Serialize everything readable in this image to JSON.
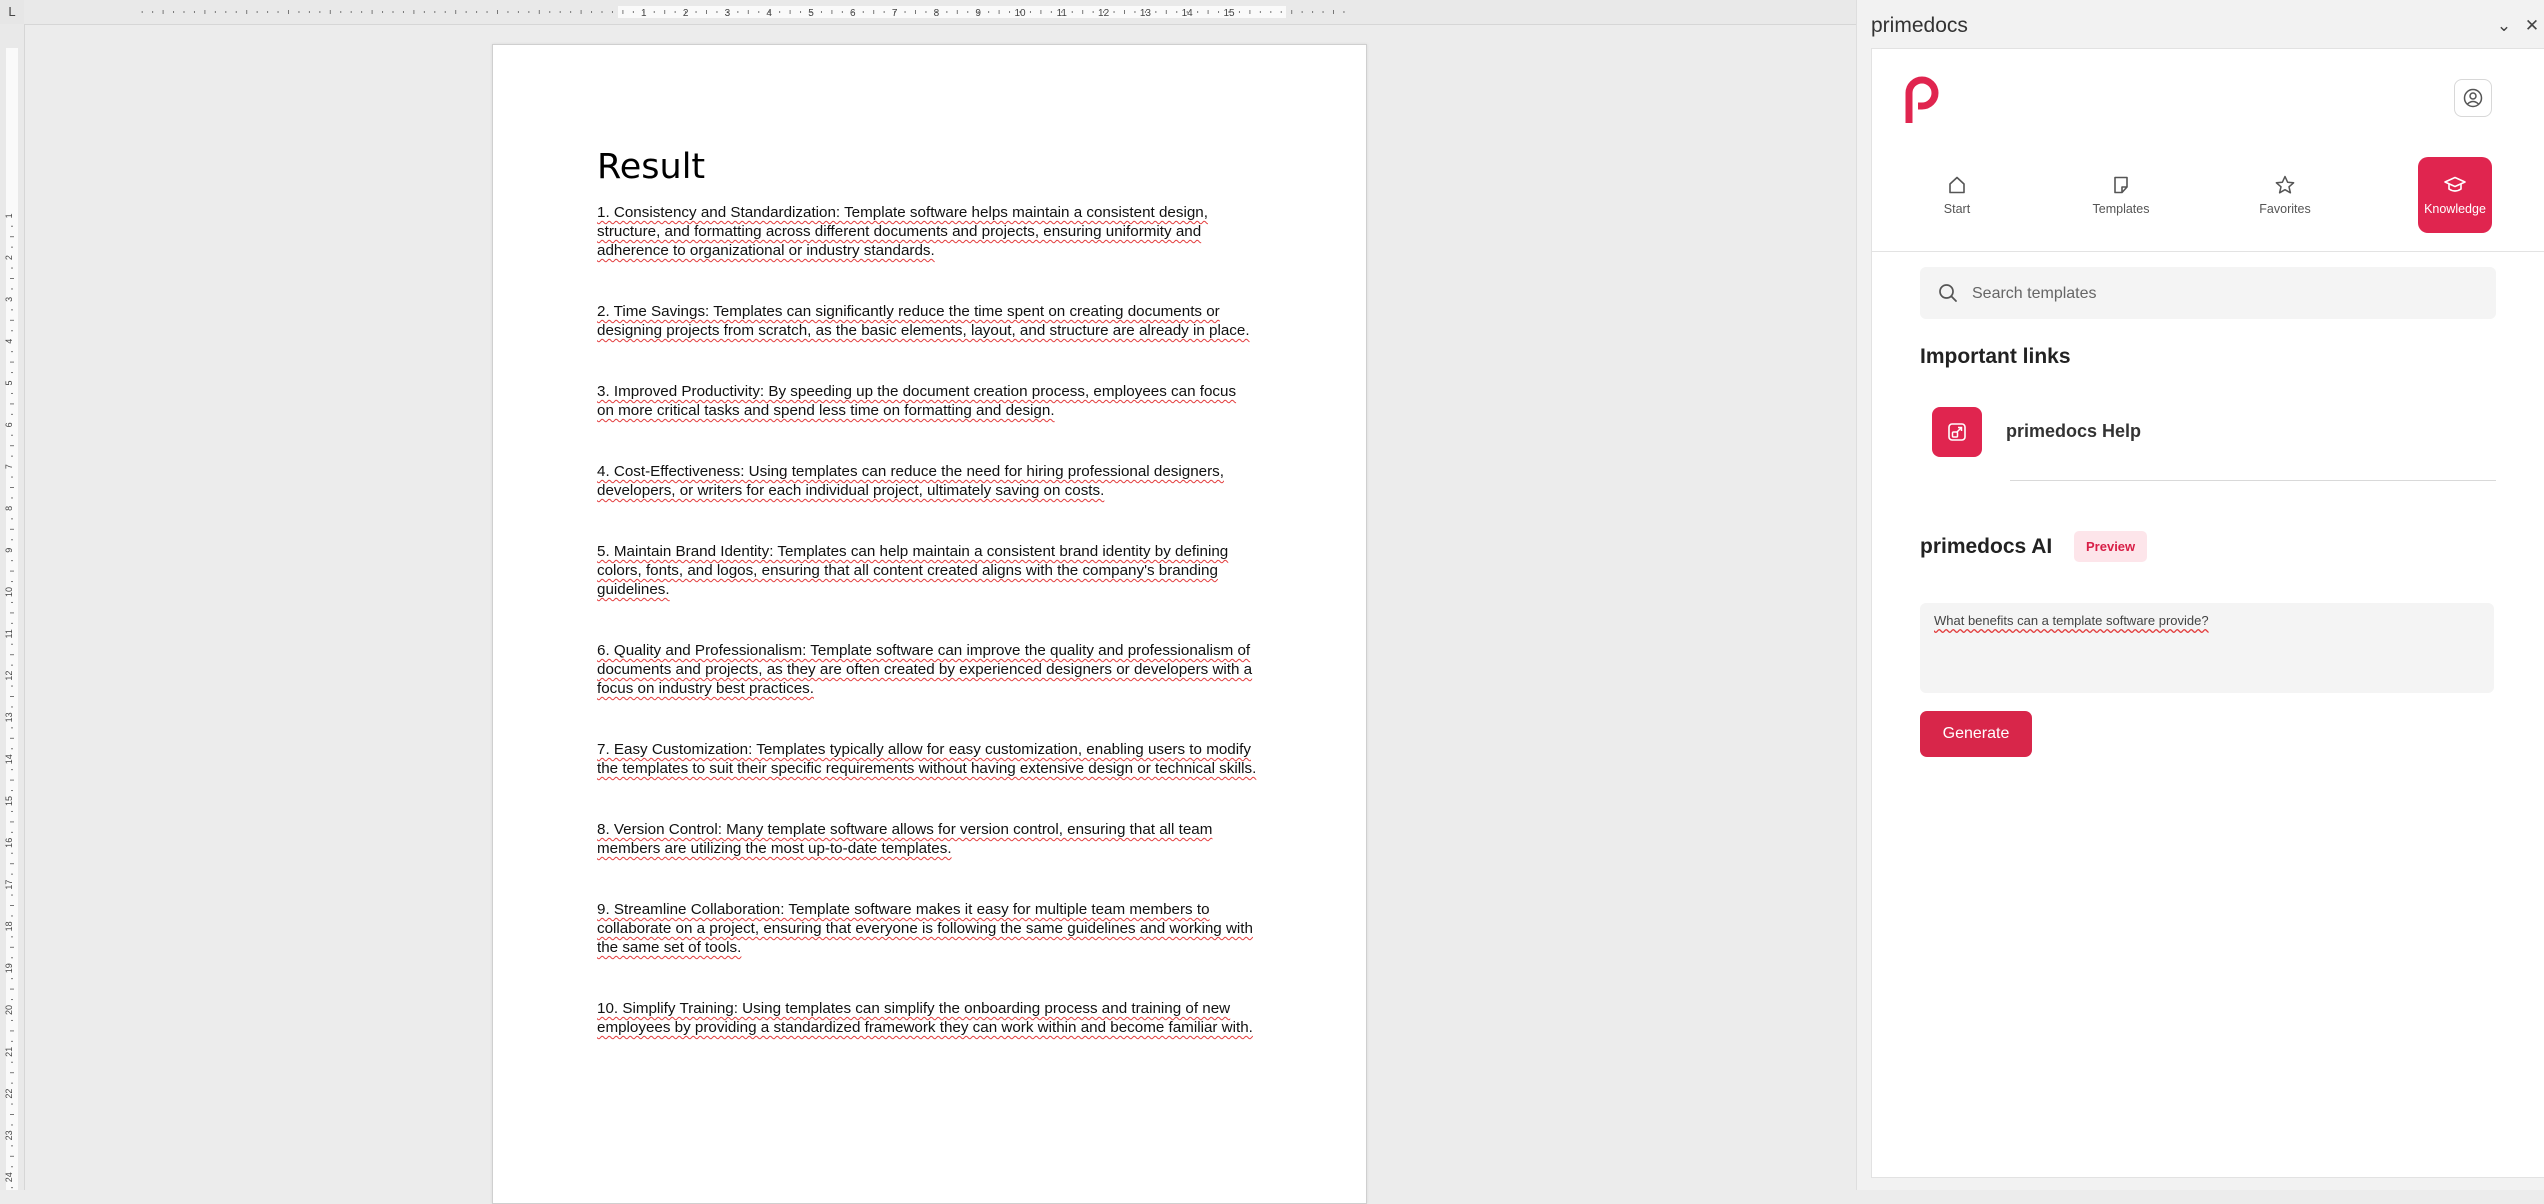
{
  "editor": {
    "ruler_corner": "L",
    "ruler_numbers": [
      "1",
      "2",
      "3",
      "4",
      "5",
      "6",
      "7",
      "8",
      "9",
      "10",
      "11",
      "12",
      "13",
      "14",
      "15"
    ],
    "vruler_numbers": [
      "1",
      "2",
      "3",
      "4",
      "5",
      "6",
      "7",
      "8",
      "9",
      "10",
      "11",
      "12",
      "13",
      "14",
      "15",
      "16",
      "17",
      "18",
      "19",
      "20",
      "21",
      "22",
      "23",
      "24"
    ],
    "document": {
      "title": "Result",
      "paragraphs": [
        "1. Consistency and Standardization: Template software helps maintain a consistent design, structure, and formatting across different documents and projects, ensuring uniformity and adherence to organizational or industry standards.",
        "2. Time Savings: Templates can significantly reduce the time spent on creating documents or designing projects from scratch, as the basic elements, layout, and structure are already in place.",
        "3. Improved Productivity: By speeding up the document creation process, employees can focus on more critical tasks and spend less time on formatting and design.",
        "4. Cost-Effectiveness: Using templates can reduce the need for hiring professional designers, developers, or writers for each individual project, ultimately saving on costs.",
        "5. Maintain Brand Identity: Templates can help maintain a consistent brand identity by defining colors, fonts, and logos, ensuring that all content created aligns with the company's branding guidelines.",
        "6. Quality and Professionalism: Template software can improve the quality and professionalism of documents and projects, as they are often created by experienced designers or developers with a focus on industry best practices.",
        "7. Easy Customization: Templates typically allow for easy customization, enabling users to modify the templates to suit their specific requirements without having extensive design or technical skills.",
        "8. Version Control: Many template software allows for version control, ensuring that all team members are utilizing the most up-to-date templates.",
        "9. Streamline Collaboration: Template software makes it easy for multiple team members to collaborate on a project, ensuring that everyone is following the same guidelines and working with the same set of tools.",
        "10. Simplify Training: Using templates can simplify the onboarding process and training of new employees by providing a standardized framework they can work within and become familiar with."
      ]
    }
  },
  "panel": {
    "title": "primedocs",
    "collapse_glyph": "⌄",
    "close_glyph": "✕",
    "nav": {
      "start": "Start",
      "templates": "Templates",
      "favorites": "Favorites",
      "knowledge": "Knowledge"
    },
    "search": {
      "placeholder": "Search templates",
      "value": ""
    },
    "links": {
      "heading": "Important links",
      "help_label": "primedocs Help"
    },
    "ai": {
      "heading": "primedocs AI",
      "badge": "Preview",
      "prompt": "What benefits can a template software provide?",
      "generate_label": "Generate"
    }
  },
  "colors": {
    "accent": "#e0254f",
    "badge_bg": "#fde5ea",
    "spell_underline": "#e23a3a"
  }
}
